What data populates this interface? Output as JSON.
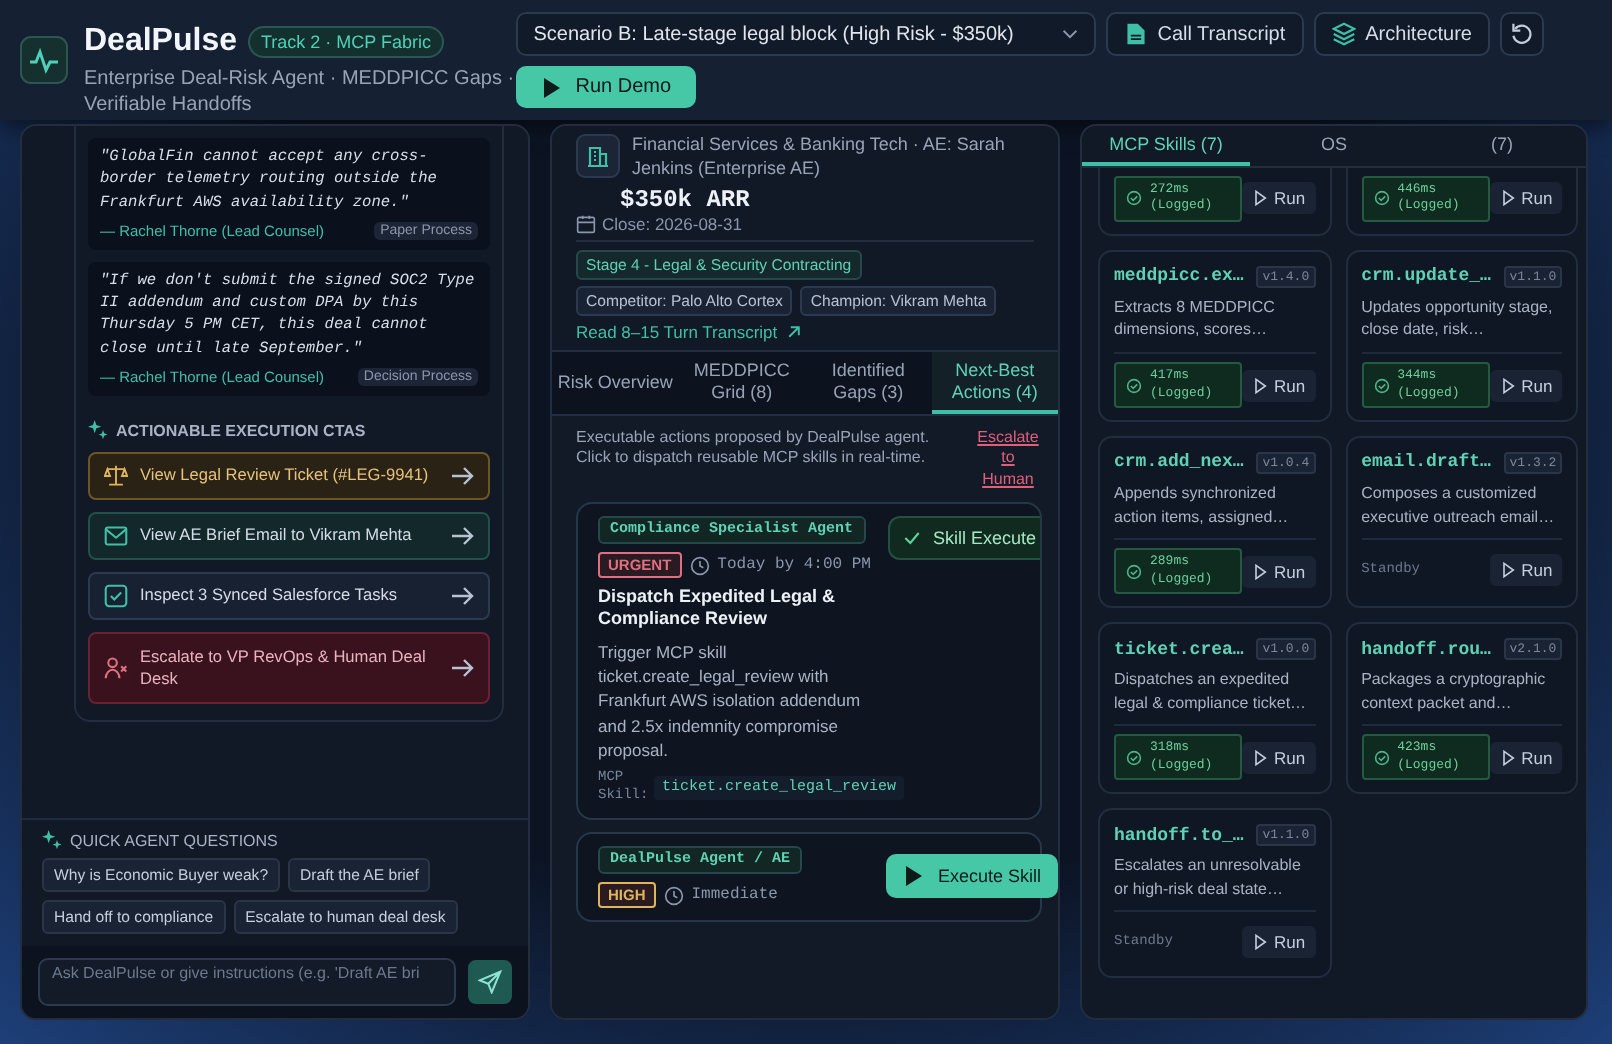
{
  "header": {
    "title": "DealPulse",
    "badge": "Track 2 · MCP Fabric",
    "subtitle": "Enterprise Deal-Risk Agent · MEDDPICC Gaps · Verifiable Handoffs"
  },
  "toolbar": {
    "scenario": "Scenario B: Late-stage legal block (High Risk - $350k)",
    "buttons": [
      {
        "label": "Call Transcript",
        "kind": "transcript"
      },
      {
        "label": "Architecture",
        "kind": "architecture"
      }
    ],
    "run_demo": "Run Demo"
  },
  "evidence": [
    {
      "text": "\"GlobalFin cannot accept any cross-border telemetry routing outside the Frankfurt AWS availability zone.\"",
      "speaker": "— Rachel Thorne (Lead Counsel)",
      "tag": "Paper Process"
    },
    {
      "text": "\"If we don't submit the signed SOC2 Type II addendum and custom DPA by this Thursday 5 PM CET, this deal cannot close until late September.\"",
      "speaker": "— Rachel Thorne (Lead Counsel)",
      "tag": "Decision Process"
    }
  ],
  "ctas": {
    "title": "ACTIONABLE EXECUTION CTAS",
    "items": [
      {
        "label": "View Legal Review Ticket (#LEG-9941)",
        "kind": "legal"
      },
      {
        "label": "View AE Brief Email to Vikram Mehta",
        "kind": "email"
      },
      {
        "label": "Inspect 3 Synced Salesforce Tasks",
        "kind": "tasks"
      },
      {
        "label": "Escalate to VP RevOps & Human Deal Desk",
        "kind": "escalate"
      }
    ]
  },
  "quick_questions": {
    "title": "QUICK AGENT QUESTIONS",
    "items": [
      "Why is Economic Buyer weak?",
      "Draft the AE brief",
      "Hand off to compliance",
      "Escalate to human deal desk"
    ]
  },
  "chat_input": {
    "placeholder": "Ask DealPulse or give instructions (e.g. 'Draft AE bri"
  },
  "deal": {
    "subtitle": "Financial Services & Banking Tech · AE: Sarah Jenkins (Enterprise AE)",
    "arr": "$350k ARR",
    "close": "Close: 2026-08-31",
    "tags": [
      {
        "label": "Stage 4 - Legal & Security Contracting",
        "kind": "stage"
      },
      {
        "label": "Competitor: Palo Alto Cortex",
        "kind": "plain"
      },
      {
        "label": "Champion: Vikram Mehta",
        "kind": "plain"
      }
    ],
    "transcript_link": "Read 8–15 Turn Transcript"
  },
  "deal_tabs": [
    {
      "label": "Risk Overview",
      "selected": false
    },
    {
      "label": "MEDDPICC Grid (8)",
      "selected": false
    },
    {
      "label": "Identified Gaps (3)",
      "selected": false
    },
    {
      "label": "Next-Best Actions (4)",
      "selected": true
    }
  ],
  "actions": {
    "intro": "Executable actions proposed by DealPulse agent. Click to dispatch reusable MCP skills in real-time.",
    "escalate": "Escalate to Human",
    "items": [
      {
        "agent": "Compliance Specialist Agent",
        "priority": "URGENT",
        "color": "#e07080",
        "due": "Today by 4:00 PM",
        "title": "Dispatch Expedited Legal & Compliance Review",
        "description": "Trigger MCP skill ticket.create_legal_review with Frankfurt AWS isolation addendum and 2.5x indemnity compromise proposal.",
        "skill_label": "MCP Skill:",
        "skill": "ticket.create_legal_review",
        "executed": true,
        "status": "Skill Execute"
      },
      {
        "agent": "DealPulse Agent / AE",
        "priority": "HIGH",
        "color": "#e0b45a",
        "due": "Immediate",
        "executed": false,
        "button": "Execute Skill"
      }
    ]
  },
  "skills_tabs": [
    {
      "label": "MCP Skills (7)",
      "selected": true
    },
    {
      "label": "OS",
      "selected": false
    },
    {
      "label": "(7)",
      "selected": false
    }
  ],
  "skills": [
    {
      "kind": "logged",
      "latency": "272ms",
      "logged": "(Logged)",
      "run": "Run"
    },
    {
      "kind": "logged",
      "latency": "446ms",
      "logged": "(Logged)",
      "run": "Run"
    },
    {
      "name": "meddpicc.ex…",
      "version": "v1.4.0",
      "description": "Extracts 8 MEDDPICC dimensions, scores…",
      "kind": "logged",
      "latency": "417ms",
      "logged": "(Logged)",
      "run": "Run"
    },
    {
      "name": "crm.update_…",
      "version": "v1.1.0",
      "description": "Updates opportunity stage, close date, risk…",
      "kind": "logged",
      "latency": "344ms",
      "logged": "(Logged)",
      "run": "Run"
    },
    {
      "name": "crm.add_nex…",
      "version": "v1.0.4",
      "description": "Appends synchronized action items, assigned…",
      "kind": "logged",
      "latency": "289ms",
      "logged": "(Logged)",
      "run": "Run"
    },
    {
      "name": "email.draft…",
      "version": "v1.3.2",
      "description": "Composes a customized executive outreach email…",
      "kind": "standby",
      "status": "Standby",
      "run": "Run"
    },
    {
      "name": "ticket.crea…",
      "version": "v1.0.0",
      "description": "Dispatches an expedited legal & compliance ticket…",
      "kind": "logged",
      "latency": "318ms",
      "logged": "(Logged)",
      "run": "Run"
    },
    {
      "name": "handoff.rou…",
      "version": "v2.1.0",
      "description": "Packages a cryptographic context packet and…",
      "kind": "logged",
      "latency": "423ms",
      "logged": "(Logged)",
      "run": "Run"
    },
    {
      "name": "handoff.to_…",
      "version": "v1.1.0",
      "description": "Escalates an unresolvable or high-risk deal state…",
      "kind": "standby",
      "status": "Standby",
      "run": "Run"
    }
  ]
}
